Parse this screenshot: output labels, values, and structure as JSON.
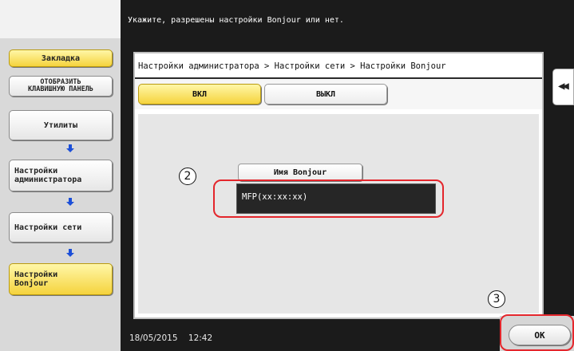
{
  "header": {
    "message": "Укажите, разрешены настройки Bonjour или нет."
  },
  "sidebar": {
    "bookmark_label": "Закладка",
    "keypad_label_line1": "ОТОБРАЗИТЬ",
    "keypad_label_line2": "КЛАВИШНУЮ ПАНЕЛЬ",
    "nav_items": [
      {
        "label": "Утилиты"
      },
      {
        "label_line1": "Настройки",
        "label_line2": "администратора"
      },
      {
        "label": "Настройки сети"
      },
      {
        "label_line1": "Настройки",
        "label_line2": "Bonjour"
      }
    ]
  },
  "main": {
    "breadcrumb": "Настройки администратора > Настройки сети > Настройки Bonjour",
    "toggle": {
      "on_label": "ВКЛ",
      "off_label": "ВЫКЛ",
      "selected": "ВКЛ"
    },
    "bonjour_name_button": "Имя Bonjour",
    "bonjour_name_value": "MFP(xx:xx:xx)"
  },
  "status_bar": {
    "date": "18/05/2015",
    "time": "12:42"
  },
  "footer": {
    "ok_label": "OK"
  },
  "annotations": {
    "callout_2": "2",
    "callout_3": "3"
  },
  "colors": {
    "accent_yellow": "#f5d33d",
    "highlight_red": "#e4262c",
    "frame_dark": "#1b1b1b",
    "nav_arrow_blue": "#1c4fd8"
  }
}
